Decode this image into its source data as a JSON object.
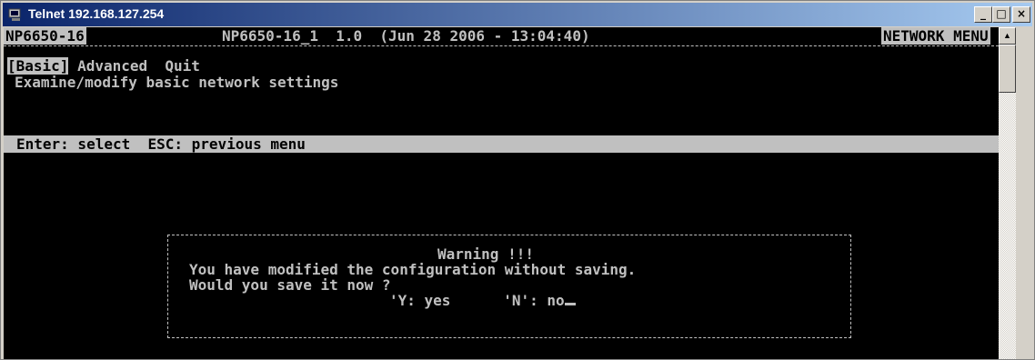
{
  "window": {
    "title": "Telnet 192.168.127.254"
  },
  "titlebar_buttons": {
    "minimize": "_",
    "maximize": "□",
    "close": "×"
  },
  "header": {
    "device": "NP6650-16",
    "info": "NP6650-16_1  1.0  (Jun 28 2006 - 13:04:40)",
    "menu_name": "NETWORK MENU"
  },
  "menu": {
    "selected": "[Basic]",
    "items": [
      "Advanced",
      "Quit"
    ],
    "description": "Examine/modify basic network settings"
  },
  "helpbar": "Enter: select  ESC: previous menu",
  "dialog": {
    "title": "Warning !!!",
    "message1": "You have modified the configuration without saving.",
    "message2": "Would you save it now ?",
    "yes_option": "'Y: yes",
    "no_option": "'N': no"
  },
  "icons": {
    "app": "telnet-icon",
    "scroll_up": "scroll-up-arrow-icon"
  }
}
